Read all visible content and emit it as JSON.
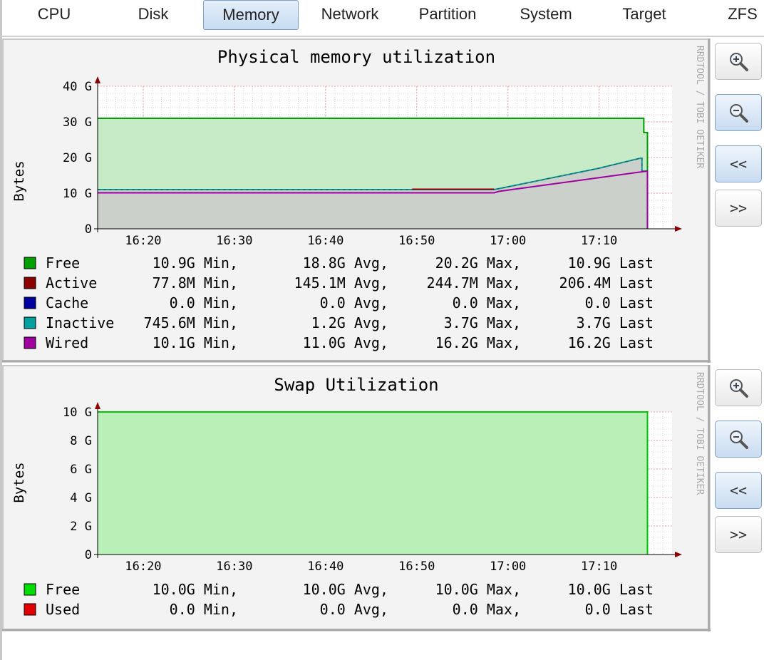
{
  "tabs": [
    {
      "label": "CPU",
      "active": false
    },
    {
      "label": "Disk",
      "active": false
    },
    {
      "label": "Memory",
      "active": true
    },
    {
      "label": "Network",
      "active": false
    },
    {
      "label": "Partition",
      "active": false
    },
    {
      "label": "System",
      "active": false
    },
    {
      "label": "Target",
      "active": false
    },
    {
      "label": "ZFS",
      "active": false
    }
  ],
  "buttons": {
    "zoom_in_icon": "zoom-in-icon",
    "zoom_out_icon": "zoom-out-icon",
    "back": "<<",
    "forward": ">>"
  },
  "watermark": "RRDTOOL / TOBI OETIKER",
  "chart_data": [
    {
      "type": "area",
      "title": "Physical memory utilization",
      "ylabel": "Bytes",
      "ylim": [
        0,
        40
      ],
      "yunit": "G",
      "yticks": [
        "0",
        "10 G",
        "20 G",
        "30 G",
        "40 G"
      ],
      "xlim": [
        "16:15",
        "17:18"
      ],
      "xticks": [
        "16:20",
        "16:30",
        "16:40",
        "16:50",
        "17:00",
        "17:10"
      ],
      "series": [
        {
          "name": "Free",
          "color": "#00a000",
          "points": [
            [
              "16:15",
              31
            ],
            [
              "17:14.9",
              31
            ],
            [
              "17:14.9",
              27
            ],
            [
              "17:15.3",
              27
            ],
            [
              "17:15.3",
              0
            ]
          ]
        },
        {
          "name": "Inactive",
          "color": "#00a0a0",
          "points": [
            [
              "16:15",
              11
            ],
            [
              "16:58.5",
              11
            ],
            [
              "17:10",
              17
            ],
            [
              "17:14.5",
              19.8
            ],
            [
              "17:14.7",
              19.8
            ],
            [
              "17:14.7",
              16.2
            ],
            [
              "17:15.3",
              16.2
            ],
            [
              "17:15.3",
              0
            ]
          ]
        },
        {
          "name": "Active",
          "color": "#8b0000",
          "points": [
            [
              "16:49.5",
              11.1
            ],
            [
              "16:58.5",
              11.1
            ]
          ]
        },
        {
          "name": "Cache",
          "color": "#0000b0",
          "points": []
        },
        {
          "name": "Wired",
          "color": "#a000a0",
          "points": [
            [
              "16:15",
              10.1
            ],
            [
              "16:58.5",
              10.1
            ],
            [
              "16:59",
              10.5
            ],
            [
              "17:15.3",
              16.2
            ],
            [
              "17:15.3",
              0
            ]
          ]
        }
      ],
      "legend": [
        {
          "name": "Free",
          "color": "#00a000",
          "min": "10.9G Min,",
          "avg": "18.8G Avg,",
          "max": "20.2G Max,",
          "last": "10.9G Last"
        },
        {
          "name": "Active",
          "color": "#8b0000",
          "min": "77.8M Min,",
          "avg": "145.1M Avg,",
          "max": "244.7M Max,",
          "last": "206.4M Last"
        },
        {
          "name": "Cache",
          "color": "#0000a0",
          "min": "0.0  Min,",
          "avg": "0.0  Avg,",
          "max": "0.0  Max,",
          "last": "0.0  Last"
        },
        {
          "name": "Inactive",
          "color": "#00a0a0",
          "min": "745.6M Min,",
          "avg": "1.2G Avg,",
          "max": "3.7G Max,",
          "last": "3.7G Last"
        },
        {
          "name": "Wired",
          "color": "#a000a0",
          "min": "10.1G Min,",
          "avg": "11.0G Avg,",
          "max": "16.2G Max,",
          "last": "16.2G Last"
        }
      ]
    },
    {
      "type": "area",
      "title": "Swap Utilization",
      "ylabel": "Bytes",
      "ylim": [
        0,
        10
      ],
      "yunit": "G",
      "yticks": [
        "0",
        "2 G",
        "4 G",
        "6 G",
        "8 G",
        "10 G"
      ],
      "xlim": [
        "16:15",
        "17:18"
      ],
      "xticks": [
        "16:20",
        "16:30",
        "16:40",
        "16:50",
        "17:00",
        "17:10"
      ],
      "series": [
        {
          "name": "Free",
          "color": "#00c800",
          "points": [
            [
              "16:15",
              10
            ],
            [
              "17:15.3",
              10
            ],
            [
              "17:15.3",
              0
            ]
          ]
        },
        {
          "name": "Used",
          "color": "#e00000",
          "points": []
        }
      ],
      "legend": [
        {
          "name": "Free",
          "color": "#00dd00",
          "min": "10.0G Min,",
          "avg": "10.0G Avg,",
          "max": "10.0G Max,",
          "last": "10.0G Last"
        },
        {
          "name": "Used",
          "color": "#e00000",
          "min": "0.0  Min,",
          "avg": "0.0  Avg,",
          "max": "0.0  Max,",
          "last": "0.0  Last"
        }
      ]
    }
  ]
}
